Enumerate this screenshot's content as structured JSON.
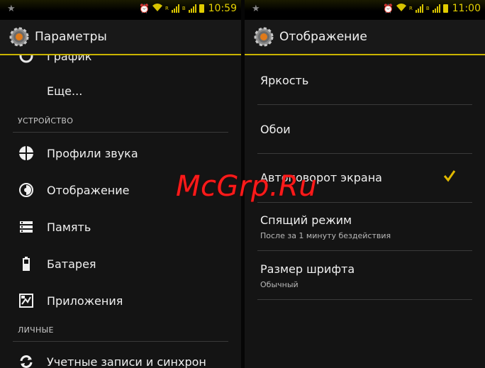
{
  "left": {
    "status": {
      "time": "10:59"
    },
    "title": "Параметры",
    "items_top": [
      {
        "label": "График",
        "icon": "data-usage-icon"
      },
      {
        "label": "Еще...",
        "icon": ""
      }
    ],
    "section_device": "УСТРОЙСТВО",
    "device_items": [
      {
        "label": "Профили звука",
        "icon": "sound-profile-icon"
      },
      {
        "label": "Отображение",
        "icon": "display-icon"
      },
      {
        "label": "Память",
        "icon": "storage-icon"
      },
      {
        "label": "Батарея",
        "icon": "battery-icon"
      },
      {
        "label": "Приложения",
        "icon": "apps-icon"
      }
    ],
    "section_personal": "ЛИЧНЫЕ",
    "personal_items": [
      {
        "label": "Учетные записи и синхрон",
        "icon": "sync-icon"
      }
    ]
  },
  "right": {
    "status": {
      "time": "11:00"
    },
    "title": "Отображение",
    "items": [
      {
        "title": "Яркость",
        "subtitle": ""
      },
      {
        "title": "Обои",
        "subtitle": ""
      },
      {
        "title": "Автоповорот экрана",
        "subtitle": "",
        "checked": true
      },
      {
        "title": "Спящий режим",
        "subtitle": "После за 1 минуту бездействия"
      },
      {
        "title": "Размер шрифта",
        "subtitle": "Обычный"
      }
    ]
  },
  "watermark": "McGrp.Ru",
  "colors": {
    "accent": "#c9b400",
    "background": "#141414",
    "statusbar_icons": "#d8c400"
  }
}
